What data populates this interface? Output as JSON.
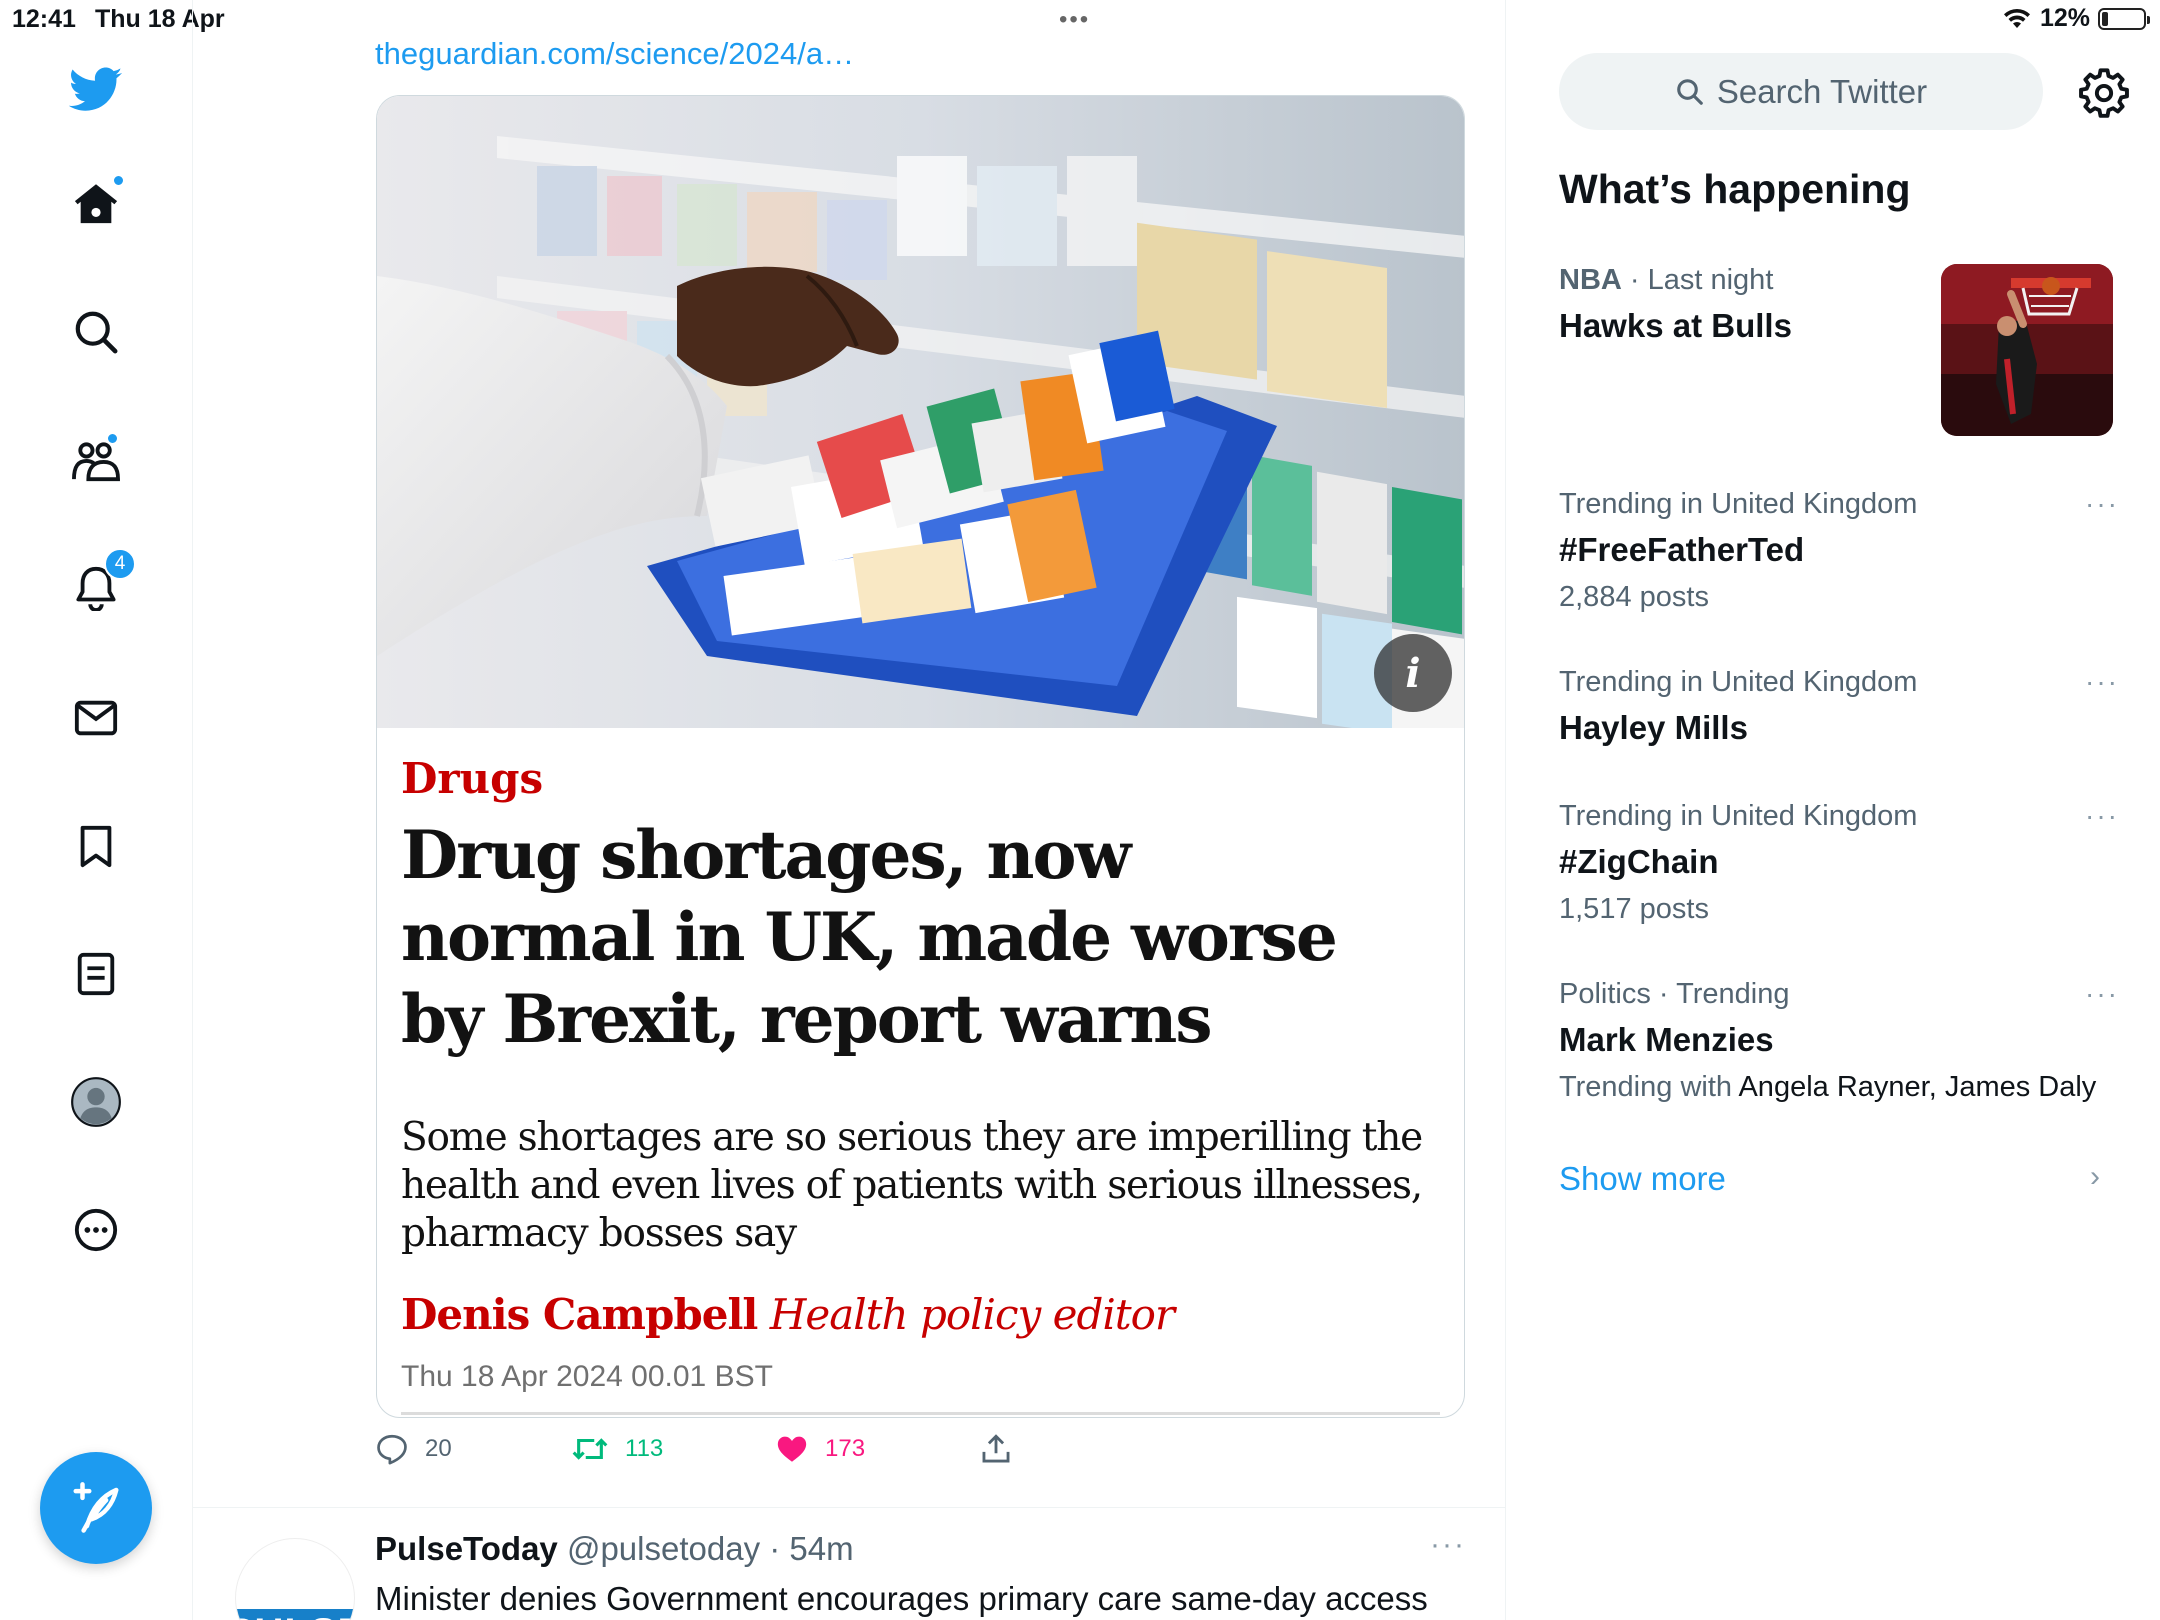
{
  "status_bar": {
    "time": "12:41",
    "date": "Thu 18 Apr",
    "multitask_dots": "•••",
    "battery_percent": "12%"
  },
  "nav": {
    "notifications_count": "4",
    "items": [
      "twitter-logo",
      "home-icon",
      "explore-icon",
      "communities-icon",
      "notifications-icon",
      "messages-icon",
      "bookmarks-icon",
      "lists-icon",
      "profile-icon",
      "more-icon"
    ]
  },
  "colors": {
    "brand": "#1d9bf0",
    "guardian_red": "#c70000",
    "retweet_green": "#00ba7c",
    "like_pink": "#f91880"
  },
  "tweet": {
    "link": "theguardian.com/science/2024/a…",
    "card": {
      "kicker": "Drugs",
      "headline": "Drug shortages, now normal in UK, made worse by Brexit, report warns",
      "standfirst": "Some shortages are so serious they are imperilling the health and even lives of patients with serious illnesses, pharmacy bosses say",
      "author": "Denis Campbell",
      "author_role": "Health policy editor",
      "date": "Thu 18 Apr 2024 00.01 BST",
      "info_icon": "i"
    },
    "actions": {
      "replies": "20",
      "retweets": "113",
      "likes": "173"
    }
  },
  "tweet2": {
    "logo_text": "PULSE",
    "name": "PulseToday",
    "handle": "@pulsetoday · 54m",
    "text": "Minister denies Government encourages primary care same-day access",
    "more": "···"
  },
  "sidebar": {
    "search_placeholder": "Search Twitter",
    "whats_happening": "What’s happening",
    "trends": [
      {
        "meta_bold": "NBA",
        "meta": " · Last night",
        "title": "Hawks at Bulls",
        "sub": ""
      },
      {
        "meta_bold": "",
        "meta": "Trending in United Kingdom",
        "title": "#FreeFatherTed",
        "sub": "2,884 posts"
      },
      {
        "meta_bold": "",
        "meta": "Trending in United Kingdom",
        "title": "Hayley Mills",
        "sub": ""
      },
      {
        "meta_bold": "",
        "meta": "Trending in United Kingdom",
        "title": "#ZigChain",
        "sub": "1,517 posts"
      },
      {
        "meta_bold": "",
        "meta": "Politics · Trending",
        "title": "Mark Menzies",
        "sub_prefix": "Trending with ",
        "sub_names": "Angela Rayner, James Daly"
      }
    ],
    "more_dots": "···",
    "show_more": "Show more",
    "chevron": "›"
  }
}
